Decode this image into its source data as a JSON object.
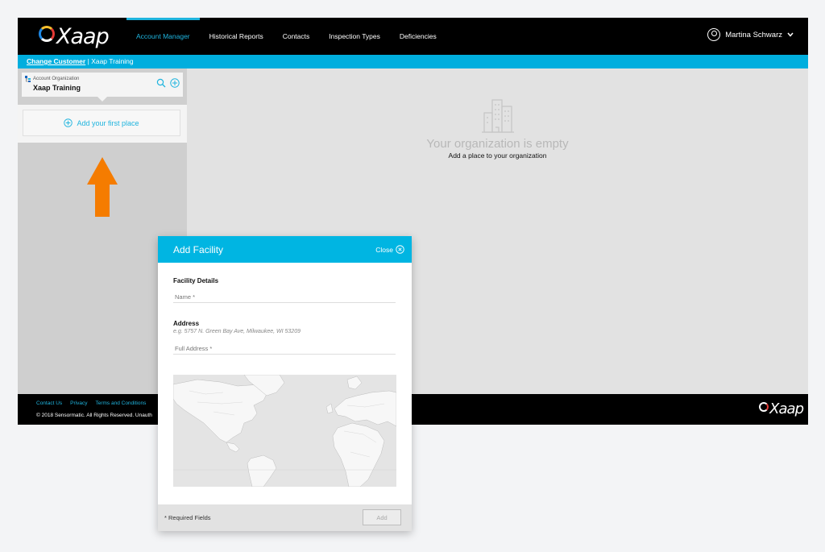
{
  "app": {
    "logo_text": "Xaap",
    "nav": [
      {
        "label": "Account Manager",
        "active": true
      },
      {
        "label": "Historical Reports",
        "active": false
      },
      {
        "label": "Contacts",
        "active": false
      },
      {
        "label": "Inspection Types",
        "active": false
      },
      {
        "label": "Deficiencies",
        "active": false
      }
    ],
    "user_name": "Martina Schwarz",
    "accent_color": "#00aede"
  },
  "subbar": {
    "change_customer": "Change Customer",
    "separator": "|",
    "customer_name": "Xaap Training"
  },
  "sidebar": {
    "org_label": "Account Organization",
    "org_name": "Xaap Training",
    "add_place": "Add your first place",
    "hint_arrow_color": "#f57c00"
  },
  "main": {
    "empty_title": "Your organization is empty",
    "empty_subtitle": "Add a place to your organization"
  },
  "footer": {
    "links": [
      "Contact Us",
      "Privacy",
      "Terms and Conditions"
    ],
    "copyright": "© 2018 Sensormatic. All Rights Reserved. Unauth",
    "logo_text": "Xaap"
  },
  "modal": {
    "title": "Add Facility",
    "close_label": "Close",
    "facility_details": "Facility Details",
    "name_placeholder": "Name *",
    "address_title": "Address",
    "address_hint": "e.g. 5757 N. Green Bay Ave, Milwaukee, WI 53209",
    "full_address_placeholder": "Full Address *",
    "required_fields": "* Required Fields",
    "add_button": "Add"
  }
}
